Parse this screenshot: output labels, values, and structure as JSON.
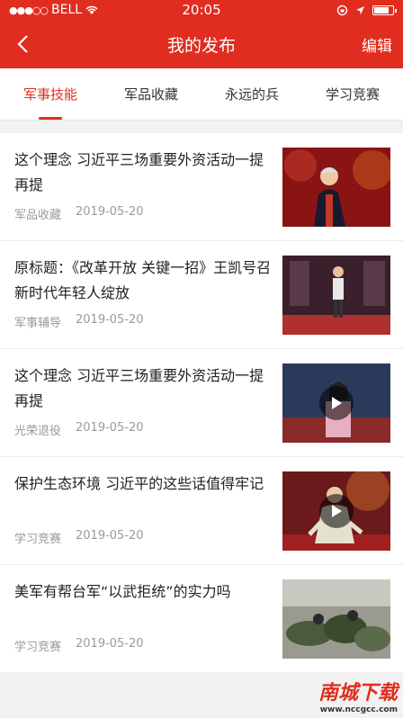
{
  "status": {
    "carrier": "BELL",
    "time": "20:05",
    "battery_level": 0.8
  },
  "nav": {
    "title": "我的发布",
    "edit": "编辑"
  },
  "tabs": [
    {
      "label": "军事技能",
      "active": true
    },
    {
      "label": "军品收藏",
      "active": false
    },
    {
      "label": "永远的兵",
      "active": false
    },
    {
      "label": "学习竞赛",
      "active": false
    }
  ],
  "items": [
    {
      "title": "这个理念 习近平三场重要外资活动一提再提",
      "category": "军品收藏",
      "date": "2019-05-20",
      "thumb": "thumb-1",
      "video": false
    },
    {
      "title": "原标题：《改革开放 关键一招》王凯号召新时代年轻人绽放",
      "category": "军事辅导",
      "date": "2019-05-20",
      "thumb": "thumb-2",
      "video": false
    },
    {
      "title": "这个理念 习近平三场重要外资活动一提再提",
      "category": "光荣退役",
      "date": "2019-05-20",
      "thumb": "thumb-3",
      "video": true
    },
    {
      "title": "保护生态环境 习近平的这些话值得牢记",
      "category": "学习竞赛",
      "date": "2019-05-20",
      "thumb": "thumb-4",
      "video": true
    },
    {
      "title": "美军有帮台军“以武拒统”的实力吗",
      "category": "学习竞赛",
      "date": "2019-05-20",
      "thumb": "thumb-5",
      "video": false
    }
  ],
  "watermark": {
    "main": "南城下载",
    "sub": "www.nccgcc.com"
  },
  "colors": {
    "accent": "#e02d1f",
    "meta": "#9a9a9a"
  }
}
